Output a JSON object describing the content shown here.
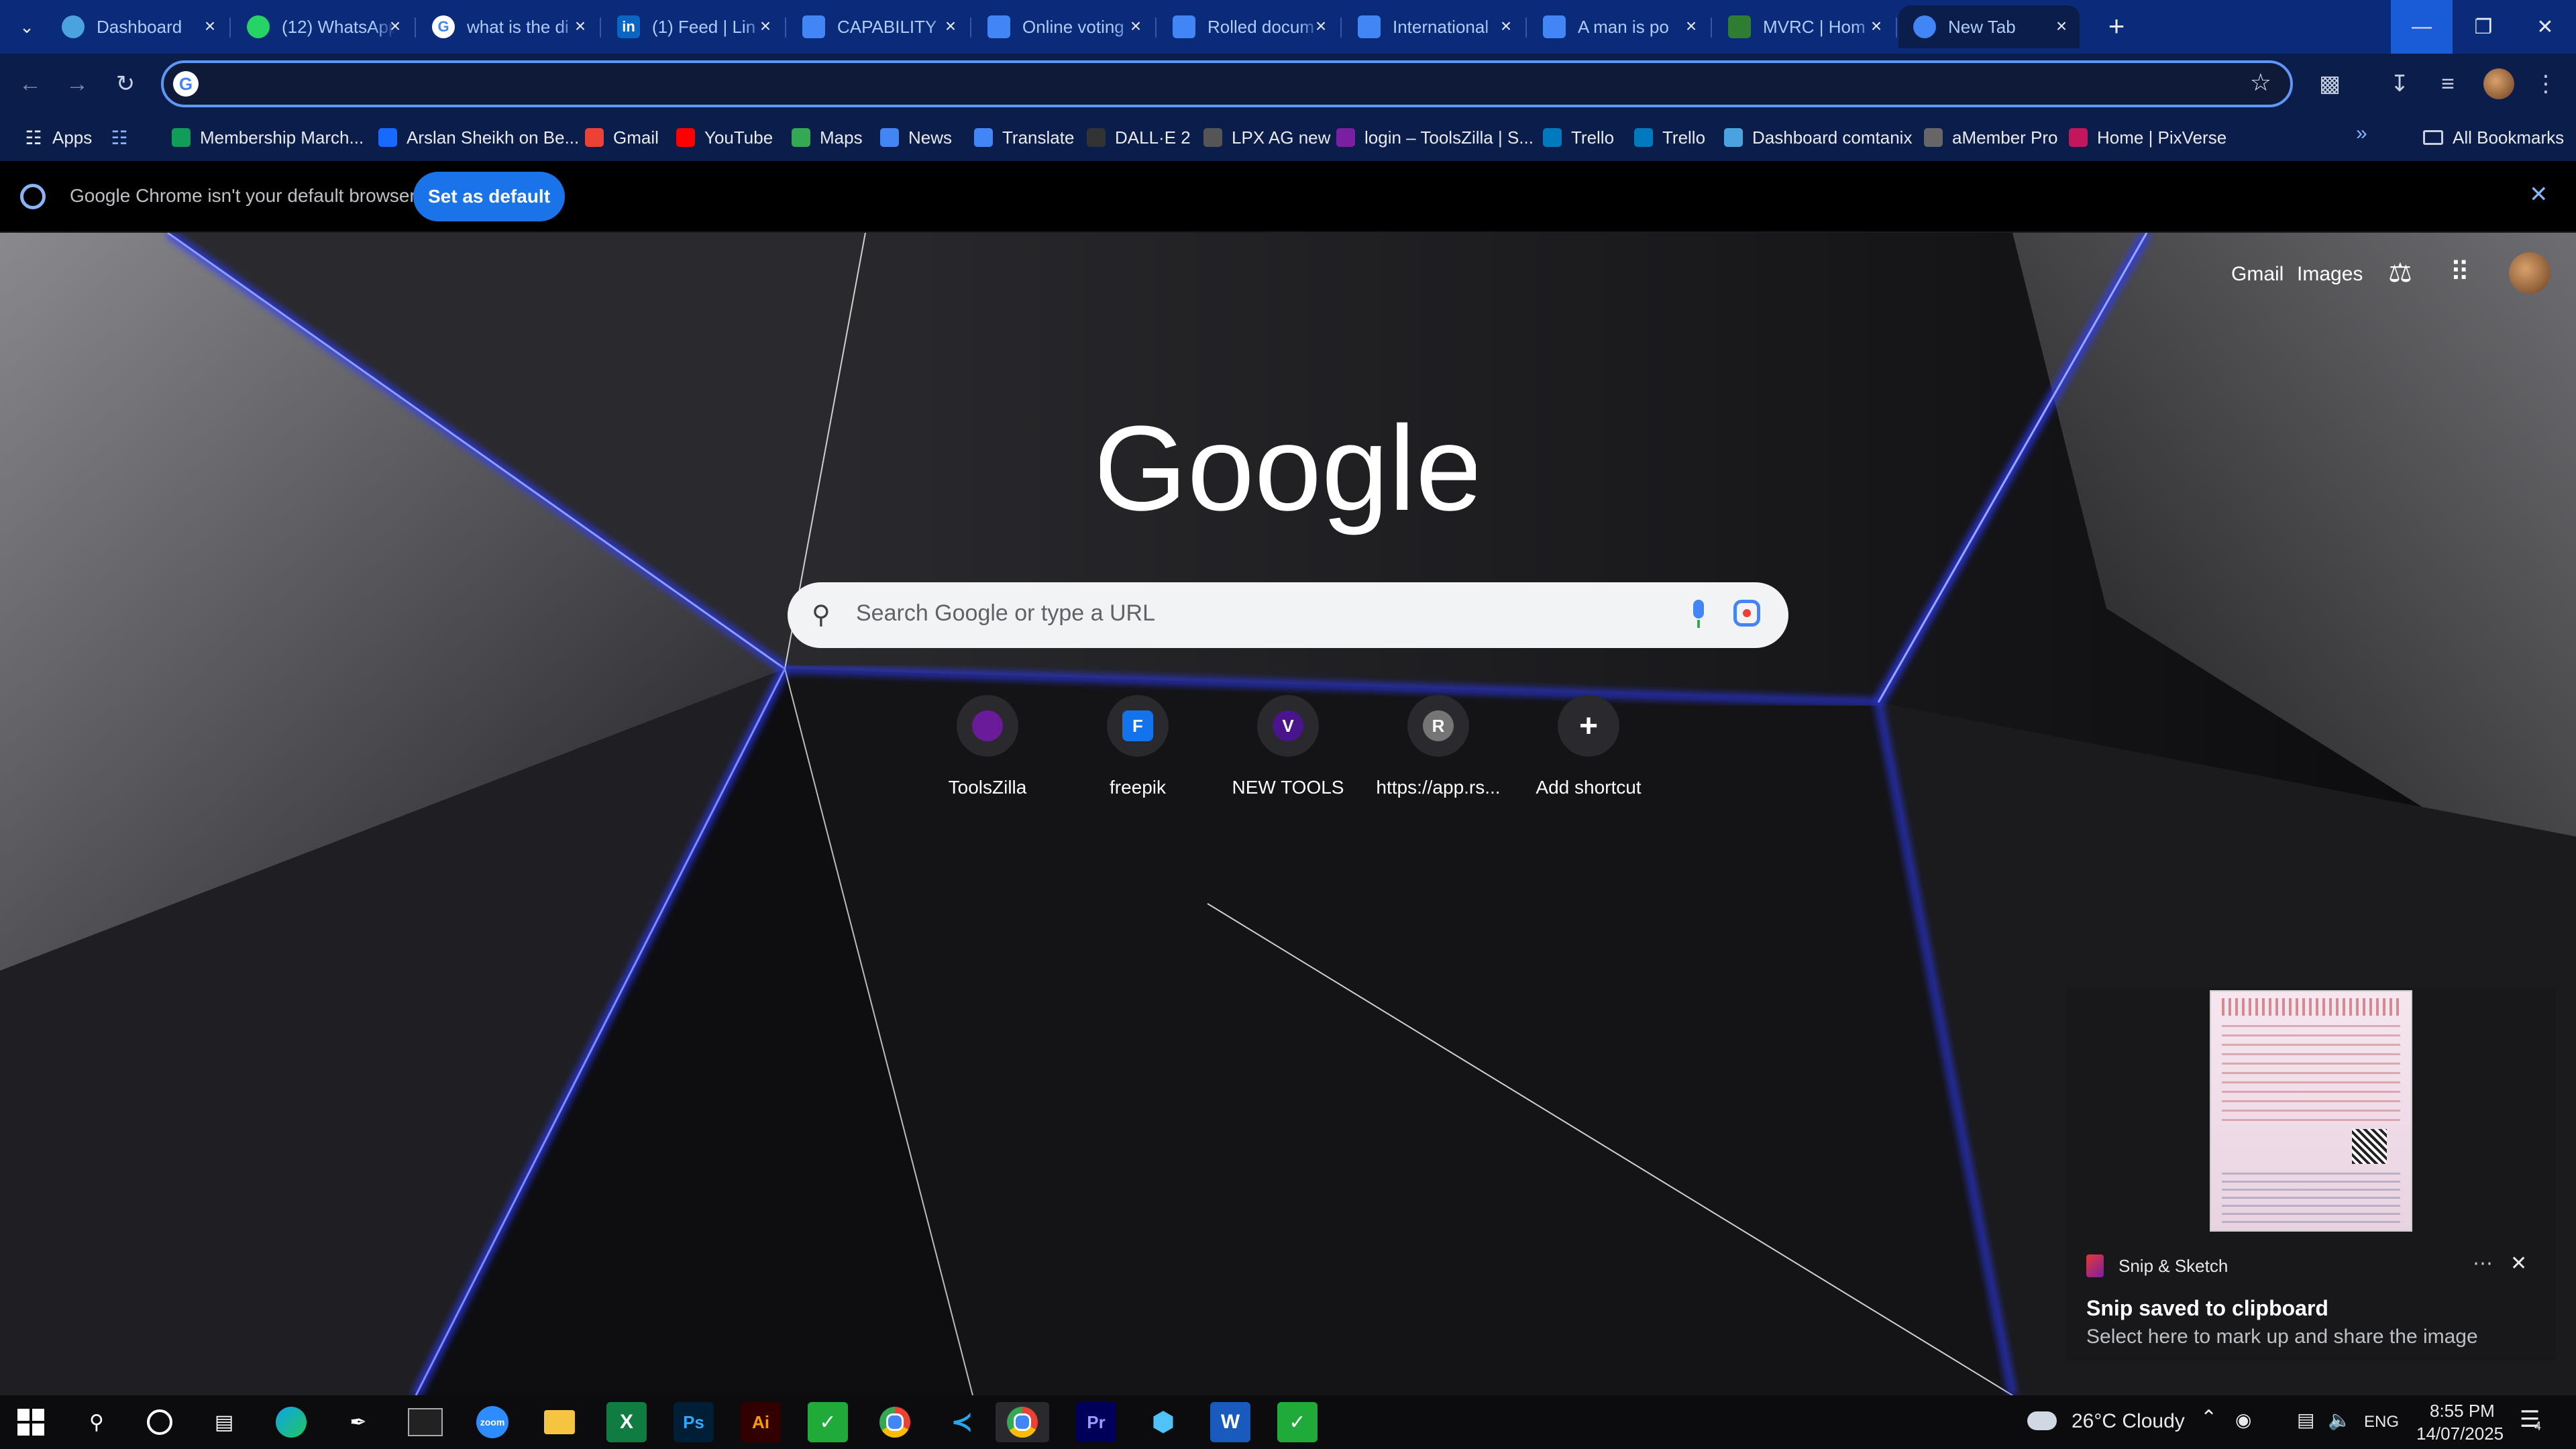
{
  "colors": {
    "accent": "#1a73e8",
    "tabstrip": "#0a2a7a",
    "toolbar": "#0b1d4b"
  },
  "tabs": [
    {
      "title": "Dashboard",
      "icon": "gauge-icon",
      "color": "#4aa3df"
    },
    {
      "title": "(12) WhatsApp",
      "icon": "whatsapp-icon",
      "color": "#25d366"
    },
    {
      "title": "what is the di",
      "icon": "google-icon",
      "color": "#ffffff"
    },
    {
      "title": "(1) Feed | Lin",
      "icon": "linkedin-icon",
      "color": "#0a66c2"
    },
    {
      "title": "CAPABILITY",
      "icon": "forms-icon",
      "color": "#4285f4"
    },
    {
      "title": "Online voting",
      "icon": "forms-icon",
      "color": "#4285f4"
    },
    {
      "title": "Rolled docum",
      "icon": "forms-icon",
      "color": "#4285f4"
    },
    {
      "title": "International",
      "icon": "forms-icon",
      "color": "#4285f4"
    },
    {
      "title": "A man is po",
      "icon": "forms-icon",
      "color": "#4285f4"
    },
    {
      "title": "MVRC | Hom",
      "icon": "mvrc-icon",
      "color": "#2e7d32"
    },
    {
      "title": "New Tab",
      "icon": "chrome-icon",
      "color": "#4285f4"
    }
  ],
  "omnibox": {
    "value": ""
  },
  "bookmarks": [
    {
      "label": "Apps",
      "icon": "apps-grid-icon"
    },
    {
      "label": "",
      "icon": "grid-icon"
    },
    {
      "label": "Membership March...",
      "icon": "sheets-icon",
      "color": "#0f9d58"
    },
    {
      "label": "Arslan Sheikh on Be...",
      "icon": "behance-icon",
      "color": "#1769ff"
    },
    {
      "label": "Gmail",
      "icon": "gmail-icon",
      "color": "#ea4335"
    },
    {
      "label": "YouTube",
      "icon": "youtube-icon",
      "color": "#ff0000"
    },
    {
      "label": "Maps",
      "icon": "maps-icon",
      "color": "#34a853"
    },
    {
      "label": "News",
      "icon": "news-icon",
      "color": "#4285f4"
    },
    {
      "label": "Translate",
      "icon": "translate-icon",
      "color": "#4285f4"
    },
    {
      "label": "DALL·E 2",
      "icon": "openai-icon",
      "color": "#333333"
    },
    {
      "label": "LPX AG new",
      "icon": "lpx-icon",
      "color": "#555555"
    },
    {
      "label": "login – ToolsZilla | S...",
      "icon": "toolszilla-icon",
      "color": "#7b1fa2"
    },
    {
      "label": "Trello",
      "icon": "trello-icon",
      "color": "#0079bf"
    },
    {
      "label": "Trello",
      "icon": "trello-icon",
      "color": "#0079bf"
    },
    {
      "label": "Dashboard comtanix",
      "icon": "gauge-icon",
      "color": "#4aa3df"
    },
    {
      "label": "aMember Pro",
      "icon": "amember-icon",
      "color": "#666666"
    },
    {
      "label": "Home | PixVerse",
      "icon": "pixverse-icon",
      "color": "#c2185b"
    }
  ],
  "all_bookmarks": "All Bookmarks",
  "infobar": {
    "message": "Google Chrome isn't your default browser",
    "button": "Set as default"
  },
  "header_links": {
    "gmail": "Gmail",
    "images": "Images"
  },
  "search": {
    "placeholder": "Search Google or type a URL"
  },
  "shortcuts": [
    {
      "label": "ToolsZilla",
      "letter": "",
      "color": "#6a1b9a"
    },
    {
      "label": "freepik",
      "letter": "F",
      "color": "#1273eb"
    },
    {
      "label": "NEW TOOLS",
      "letter": "V",
      "color": "#4a148c"
    },
    {
      "label": "https://app.rs...",
      "letter": "R",
      "color": "#757575"
    },
    {
      "label": "Add shortcut",
      "letter": "+",
      "color": "#2a2a2e"
    }
  ],
  "notification": {
    "app": "Snip & Sketch",
    "title": "Snip saved to clipboard",
    "body": "Select here to mark up and share the image"
  },
  "taskbar": {
    "weather": "26°C  Cloudy",
    "lang": "ENG",
    "time": "8:55 PM",
    "date": "14/07/2025",
    "notif_count": "4"
  }
}
